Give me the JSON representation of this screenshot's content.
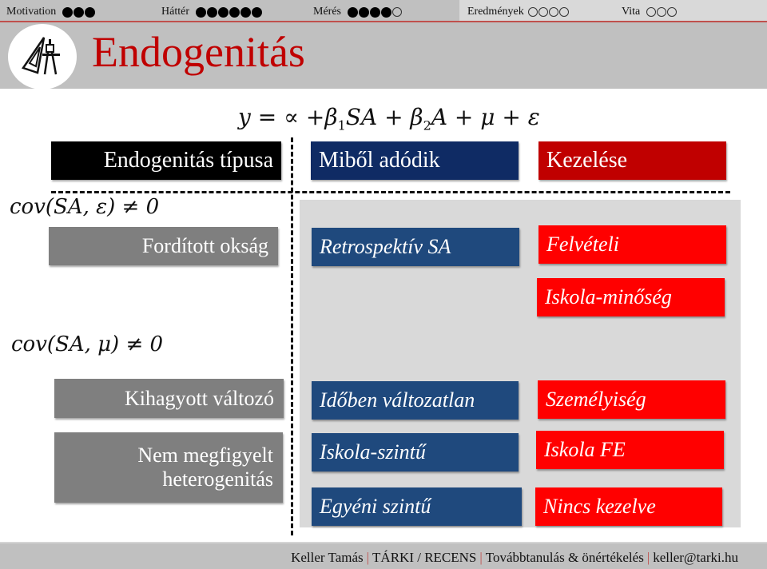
{
  "nav": {
    "items": [
      {
        "label": "Motivation",
        "filled": 3,
        "empty": 0
      },
      {
        "label": "Háttér",
        "filled": 6,
        "empty": 0
      },
      {
        "label": "Mérés",
        "filled": 4,
        "empty": 1
      },
      {
        "label": "Eredmények",
        "filled": 0,
        "empty": 4
      },
      {
        "label": "Vita",
        "filled": 0,
        "empty": 3
      }
    ]
  },
  "header": {
    "title": "Endogenitás",
    "logo_icon": "drafting-tools-icon"
  },
  "formula": {
    "y": "y = ∝ +β",
    "b1_sub": "1",
    "mid": "SA + β",
    "b2_sub": "2",
    "tail": "A + μ + ε"
  },
  "columns": {
    "type_header": "Endogenitás típusa",
    "source_header": "Miből adódik",
    "treatment_header": "Kezelése"
  },
  "groups": [
    {
      "condition": "cov(SA, ε) ≠ 0",
      "types": [
        "Fordított okság"
      ],
      "sources": [
        "Retrospektív SA"
      ],
      "treatments": [
        "Felvételi",
        "Iskola-minőség"
      ]
    },
    {
      "condition": "cov(SA, μ) ≠ 0",
      "types": [
        "Kihagyott változó",
        "Nem megfigyelt heterogenitás"
      ],
      "sources": [
        "Időben változatlan",
        "Iskola-szintű",
        "Egyéni szintű"
      ],
      "treatments": [
        "Személyiség",
        "Iskola FE",
        "Nincs kezelve"
      ]
    }
  ],
  "type_lines": {
    "nm_line1": "Nem megfigyelt",
    "nm_line2": "heterogenitás"
  },
  "footer": {
    "author": "Keller Tamás",
    "org": "TÁRKI / RECENS",
    "topic": "Továbbtanulás & önértékelés",
    "email": "keller@tarki.hu",
    "separator": "|"
  },
  "colors": {
    "title_red": "#c00000",
    "accent_rule": "#c0504d",
    "navy": "#0f2b64",
    "blue": "#1f497d",
    "red": "#ff0000",
    "gray_box": "#7f7f7f",
    "panel": "#d9d9d9"
  }
}
